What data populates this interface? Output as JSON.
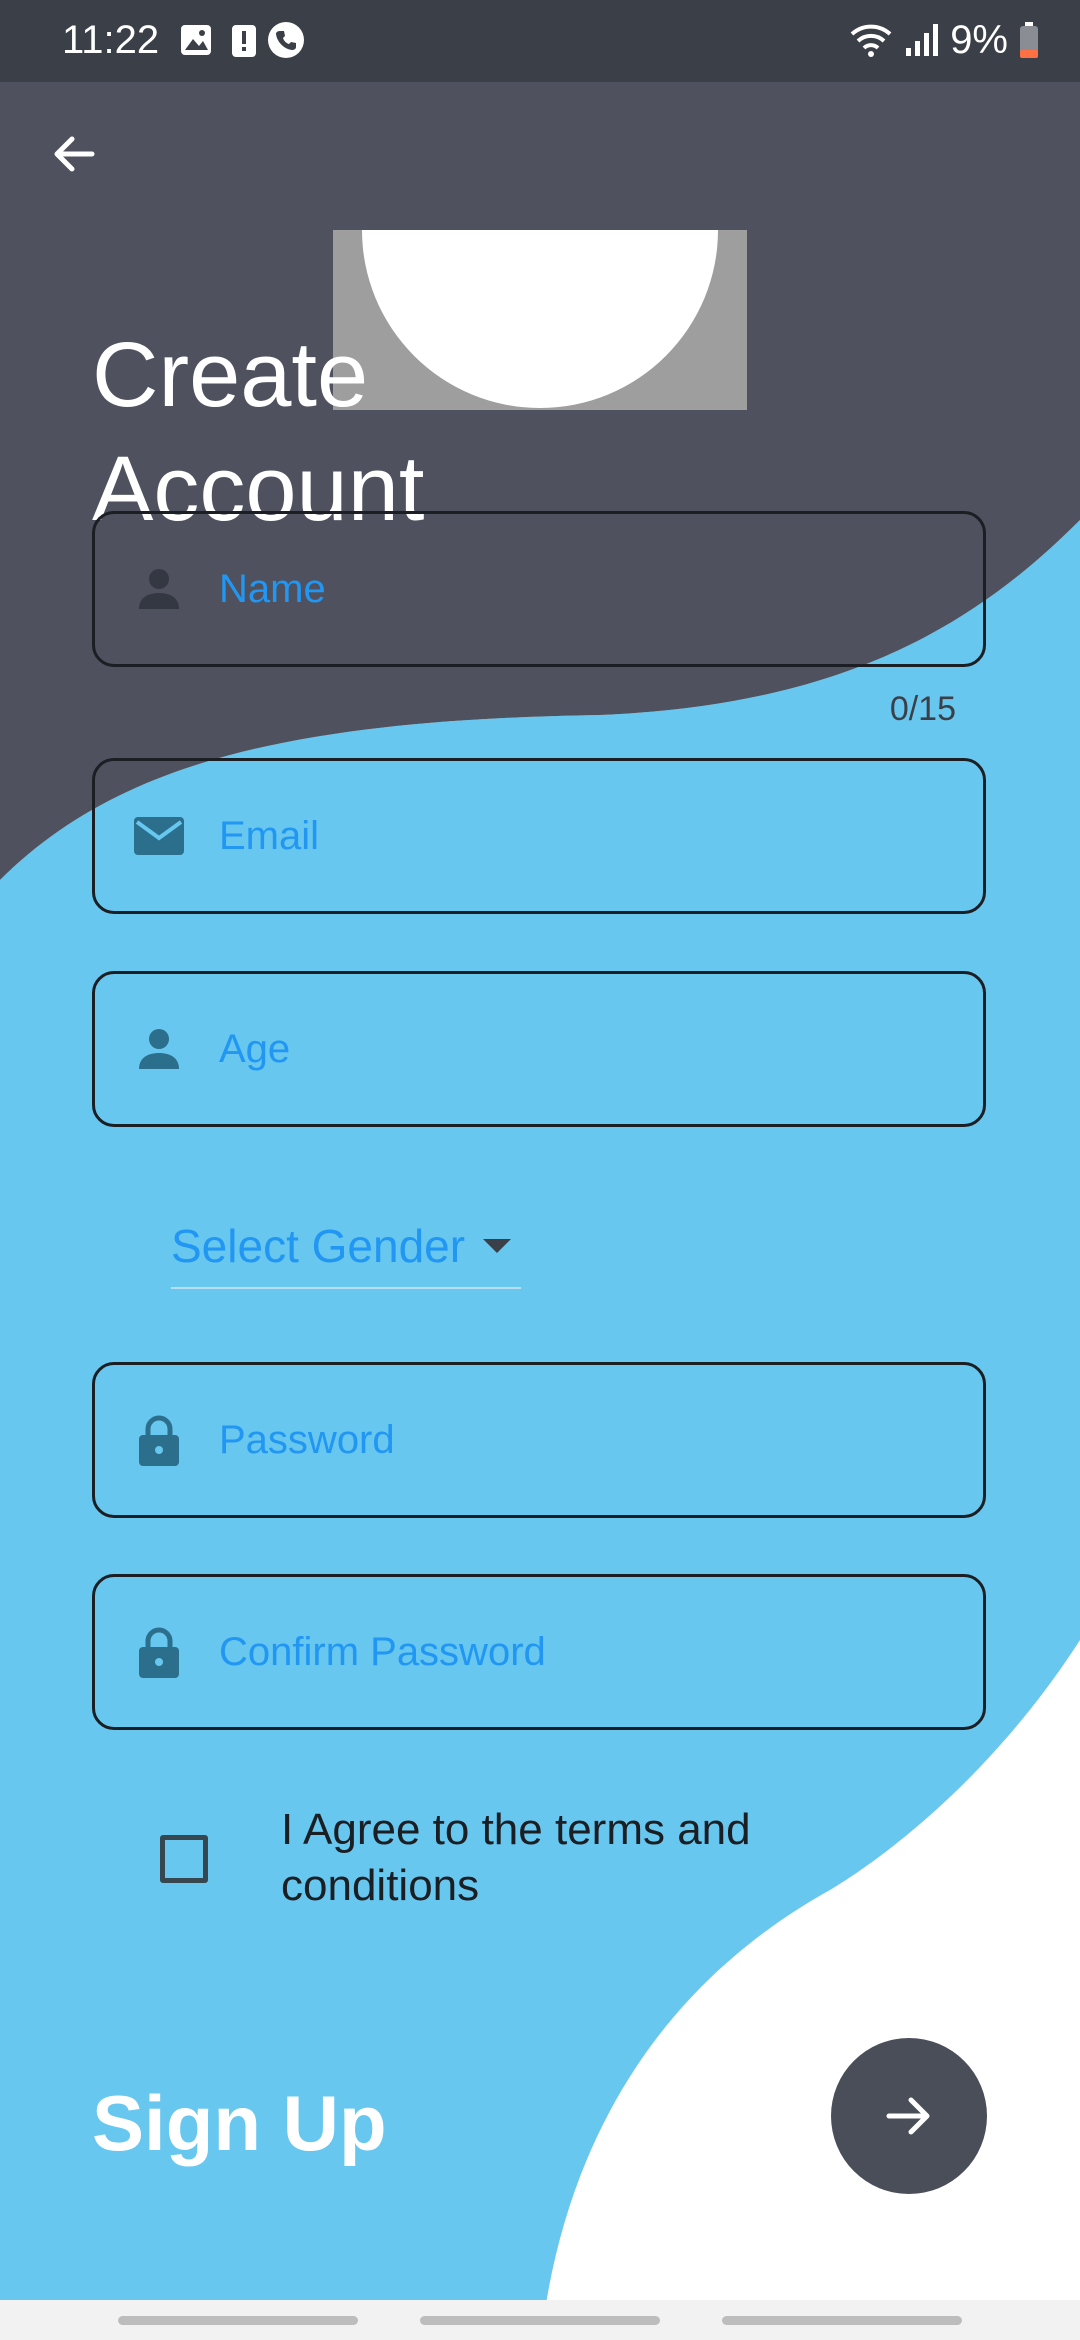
{
  "status_bar": {
    "time": "11:22",
    "battery": "9%"
  },
  "form": {
    "title": "Create\nAccount",
    "name": {
      "placeholder": "Name",
      "counter": "0/15"
    },
    "email": {
      "placeholder": "Email"
    },
    "age": {
      "placeholder": "Age"
    },
    "gender": {
      "label": "Select Gender"
    },
    "password": {
      "placeholder": "Password"
    },
    "confirm_password": {
      "placeholder": "Confirm Password"
    },
    "terms": {
      "label": "I Agree to the terms and conditions",
      "checked": false
    },
    "signup_label": "Sign Up"
  },
  "colors": {
    "dark": "#4f525e",
    "blue": "#67c7ef",
    "accent": "#2196f3",
    "white": "#ffffff"
  },
  "icons": {
    "back": "arrow-left-icon",
    "name": "person-icon",
    "email": "mail-icon",
    "age": "person-icon",
    "password": "lock-icon",
    "confirm_password": "lock-icon",
    "submit": "arrow-right-icon"
  }
}
